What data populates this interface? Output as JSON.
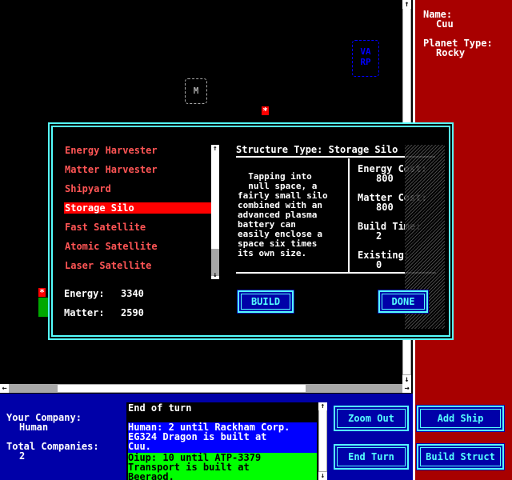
{
  "map": {
    "fleet_marker_top": "VA",
    "fleet_marker_bottom": "RP",
    "planet_marker": "M",
    "star_glyph": "*"
  },
  "info": {
    "name_label": "Name:",
    "name_value": "Cuu",
    "planet_type_label": "Planet Type:",
    "planet_type_value": "Rocky"
  },
  "dialog": {
    "structures": [
      "Energy Harvester",
      "Matter Harvester",
      "Shipyard",
      "Storage Silo",
      "Fast Satellite",
      "Atomic Satellite",
      "Laser Satellite"
    ],
    "selected_index": 3,
    "structure_type_label": "Structure Type: Storage Silo",
    "description_lines": [
      "  Tapping into",
      "  null space, a",
      "fairly small silo",
      "combined with an",
      "advanced plasma",
      "battery can",
      "easily enclose a",
      "space six times",
      "its own size."
    ],
    "energy_cost_label": "Energy Cost:",
    "energy_cost_value": "800",
    "matter_cost_label": "Matter Cost:",
    "matter_cost_value": "800",
    "build_time_label": "Build Time:",
    "build_time_value": "2",
    "existing_label": "Existing:",
    "existing_value": "0",
    "energy_label": "Energy:",
    "energy_value": "3340",
    "matter_label": "Matter:",
    "matter_value": "2590",
    "build_button": "BUILD",
    "done_button": "DONE"
  },
  "bottom": {
    "your_company_label": "Your Company:",
    "your_company_value": "Human",
    "total_companies_label": "Total Companies:",
    "total_companies_value": "2",
    "log": [
      {
        "text": "End of turn",
        "bg": "#000000",
        "fg": "#ffffff"
      },
      {
        "text": "Human: 2 until Rackham Corp.\nEG324 Dragon is built at\nCuu.",
        "bg": "#0000ff",
        "fg": "#ffffff"
      },
      {
        "text": "Oiup: 10 until ATP-3379\nTransport is built at\nBeeraod.",
        "bg": "#00ff00",
        "fg": "#000000"
      }
    ],
    "zoom_out": "Zoom Out",
    "end_turn": "End Turn",
    "add_ship": "Add Ship",
    "build_struct": "Build Struct"
  },
  "colors": {
    "list_text": "#ff5555",
    "selected_bg": "#ff0000",
    "cyan": "#55ffff",
    "panel_red": "#a80000",
    "panel_blue": "#0000a8"
  }
}
